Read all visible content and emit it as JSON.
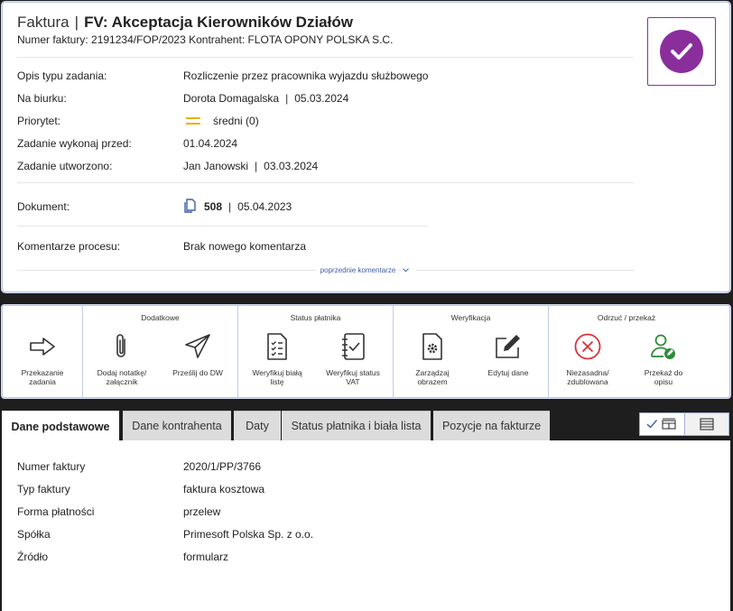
{
  "header": {
    "category": "Faktura",
    "separator": "|",
    "task_name": "FV: Akceptacja Kierowników Działów",
    "subtitle": "Numer faktury: 2191234/FOP/2023 Kontrahent: FLOTA OPONY POLSKA S.C."
  },
  "details": {
    "task_type_label": "Opis typu zadania:",
    "task_type_value": "Rozliczenie przez pracownika wyjazdu służbowego",
    "desk_label": "Na biurku:",
    "desk_person": "Dorota Domagalska",
    "desk_date": "05.03.2024",
    "priority_label": "Priorytet:",
    "priority_value": "średni (0)",
    "due_label": "Zadanie wykonaj przed:",
    "due_value": "01.04.2024",
    "created_label": "Zadanie utworzono:",
    "created_person": "Jan Janowski",
    "created_date": "03.03.2024",
    "document_label": "Dokument:",
    "document_number": "508",
    "document_date": "05.04.2023",
    "comments_label": "Komentarze procesu:",
    "comments_value": "Brak nowego komentarza",
    "previous_comments": "poprzednie komentarze"
  },
  "toolbar": {
    "groups": [
      {
        "title": "",
        "actions": [
          "Przekazanie\nzadania"
        ]
      },
      {
        "title": "Dodatkowe",
        "actions": [
          "Dodaj notatkę/\nzałącznik",
          "Prześlij do DW"
        ]
      },
      {
        "title": "Status płatnika",
        "actions": [
          "Weryfikuj białą\nlistę",
          "Weryfikuj status\nVAT"
        ]
      },
      {
        "title": "Weryfikacja",
        "actions": [
          "Zarządzaj\nobrazem",
          "Edytuj dane"
        ]
      },
      {
        "title": "Odrzuć / przekaż",
        "actions": [
          "Niezasadna/\nzdublowana",
          "Przekaż do\nopisu"
        ]
      }
    ]
  },
  "tabs": [
    {
      "label": "Dane podstawowe",
      "active": true
    },
    {
      "label": "Dane kontrahenta",
      "active": false
    },
    {
      "label": "Daty",
      "active": false
    },
    {
      "label": "Status płatnika i biała lista",
      "active": false
    },
    {
      "label": "Pozycje na fakturze",
      "active": false
    }
  ],
  "basic_data": [
    {
      "label": "Numer faktury",
      "value": "2020/1/PP/3766"
    },
    {
      "label": "Typ faktury",
      "value": "faktura kosztowa"
    },
    {
      "label": "Forma płatności",
      "value": "przelew"
    },
    {
      "label": "Spółka",
      "value": "Primesoft Polska Sp. z o.o."
    },
    {
      "label": "Źródło",
      "value": "formularz"
    }
  ],
  "colors": {
    "accent_purple": "#8a2e9c",
    "link_blue": "#3e5fa6",
    "reject_red": "#d8343c",
    "forward_green": "#2e8b3a",
    "priority_yellow": "#e2b417"
  },
  "icons": {
    "complete": "check-circle-icon",
    "document": "document-icon",
    "transfer": "arrow-right-icon",
    "note": "paperclip-icon",
    "send": "paper-plane-icon",
    "whitelist": "checklist-icon",
    "vat": "notebook-check-icon",
    "image": "gear-document-icon",
    "edit": "edit-pencil-icon",
    "reject": "x-circle-icon",
    "forward": "user-check-icon"
  }
}
